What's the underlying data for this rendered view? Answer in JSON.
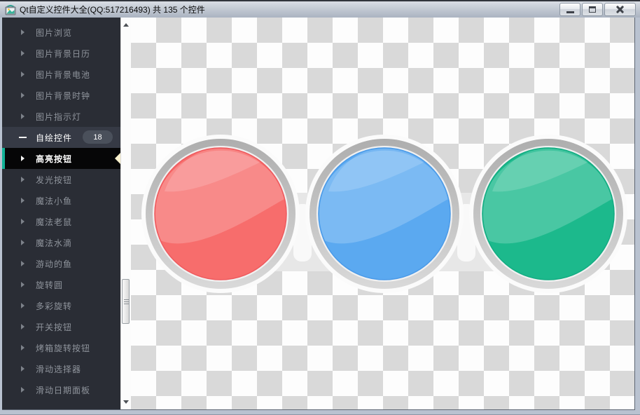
{
  "window": {
    "title": "Qt自定义控件大全(QQ:517216493) 共 135 个控件",
    "controls": [
      {
        "name": "minimize",
        "icon": "minimize-icon"
      },
      {
        "name": "maximize",
        "icon": "maximize-icon"
      },
      {
        "name": "close",
        "icon": "close-icon"
      }
    ],
    "app_icon": "picture-viewer-icon"
  },
  "sidebar": {
    "items": [
      {
        "label": "图片浏览",
        "type": "parent"
      },
      {
        "label": "图片背景日历",
        "type": "parent"
      },
      {
        "label": "图片背景电池",
        "type": "parent"
      },
      {
        "label": "图片背景时钟",
        "type": "parent"
      },
      {
        "label": "图片指示灯",
        "type": "parent"
      },
      {
        "label": "自绘控件",
        "type": "parent-expanded",
        "badge": "18"
      },
      {
        "label": "高亮按钮",
        "type": "child",
        "selected": true
      },
      {
        "label": "发光按钮",
        "type": "child"
      },
      {
        "label": "魔法小鱼",
        "type": "child"
      },
      {
        "label": "魔法老鼠",
        "type": "child"
      },
      {
        "label": "魔法水滴",
        "type": "child"
      },
      {
        "label": "游动的鱼",
        "type": "child"
      },
      {
        "label": "旋转圆",
        "type": "child"
      },
      {
        "label": "多彩旋转",
        "type": "child"
      },
      {
        "label": "开关按钮",
        "type": "child"
      },
      {
        "label": "烤箱旋转按钮",
        "type": "child"
      },
      {
        "label": "滑动选择器",
        "type": "child"
      },
      {
        "label": "滑动日期面板",
        "type": "child"
      }
    ],
    "scrollbar": {
      "thumb_position": "middle"
    }
  },
  "main": {
    "demo_name": "高亮按钮",
    "buttons": [
      {
        "name": "red-highlight-button",
        "color": "#f76d6c",
        "stroke": "#ef5a5e"
      },
      {
        "name": "blue-highlight-button",
        "color": "#5ba9f0",
        "stroke": "#4a9ae8"
      },
      {
        "name": "green-highlight-button",
        "color": "#1cb98c",
        "stroke": "#13ac82"
      }
    ],
    "ring_colors": {
      "rim": "#fbfbfb",
      "ring_top": "#aeaeae",
      "ring_bottom": "#d9d9d9",
      "inner": "#f1f1f1"
    },
    "checker": {
      "light": "#fdfdfd",
      "dark": "#d9d9d9"
    }
  },
  "theme": {
    "sidebar_bg": "#2a2d35",
    "sidebar_text": "#8f949c",
    "selected_bg": "#060607",
    "accent_teal": "#12b298",
    "marker_cream": "#fcf3cf",
    "badge_bg": "#4a505b",
    "titlebar_top": "#d9dee5",
    "titlebar_bottom": "#aab3c1"
  }
}
